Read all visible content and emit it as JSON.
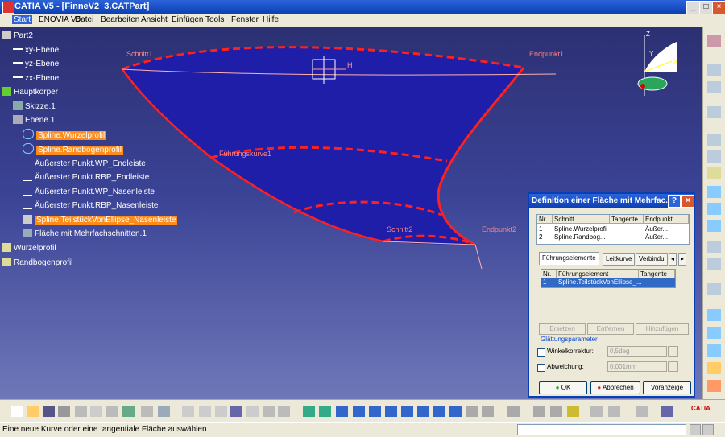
{
  "window": {
    "title": "CATIA V5 - [FinneV2_3.CATPart]"
  },
  "menu": [
    "Start",
    "ENOVIA V5",
    "Datei",
    "Bearbeiten",
    "Ansicht",
    "Einfügen",
    "Tools",
    "Fenster",
    "Hilfe"
  ],
  "tree": {
    "root": "Part2",
    "planes": [
      "xy-Ebene",
      "yz-Ebene",
      "zx-Ebene"
    ],
    "body": "Hauptkörper",
    "body_items": [
      "Skizze.1",
      "Ebene.1",
      "Spline.Wurzelprofil",
      "Spline.Randbogenprofil",
      "Äußerster Punkt.WP_Endleiste",
      "Äußerster Punkt.RBP_Endleiste",
      "Äußerster Punkt.WP_Nasenleiste",
      "Äußerster Punkt.RBP_Nasenleiste",
      "Spline.TeilstückVonEllipse_Nasenleiste",
      "Fläche mit Mehrfachschnitten.1"
    ],
    "others": [
      "Wurzelprofil",
      "Randbogenprofil"
    ]
  },
  "viewport": {
    "labels": [
      "Schnitt1",
      "Endpunkt1",
      "Führungskurve1",
      "Schnitt2",
      "Endpunkt2"
    ],
    "compass_axes": [
      "Z",
      "Y",
      "X"
    ],
    "plane_label": "H"
  },
  "dialog": {
    "title": "Definition einer Fläche mit Mehrfac...",
    "sections_header": [
      "Nr.",
      "Schnitt",
      "Tangente",
      "Endpunkt"
    ],
    "sections": [
      {
        "nr": "1",
        "name": "Spline.Wurzelprofil",
        "tangent": "",
        "end": "Äußer..."
      },
      {
        "nr": "2",
        "name": "Spline.Randbog...",
        "tangent": "",
        "end": "Äußer..."
      }
    ],
    "tabs": [
      "Führungselemente",
      "Leitkurve",
      "Verbindu"
    ],
    "guide_header": [
      "Nr.",
      "Führungselement",
      "Tangente"
    ],
    "guides": [
      {
        "nr": "1",
        "name": "Spline.TeilstückVonEllipse_..."
      }
    ],
    "buttons": [
      "Ersetzen",
      "Entfernen",
      "Hinzufügen"
    ],
    "smoothing_label": "Glättungsparameter",
    "angle_label": "Winkelkorrektur:",
    "angle_value": "0,5deg",
    "deviation_label": "Abweichung:",
    "deviation_value": "0,001mm",
    "ok": "OK",
    "cancel": "Abbrechen",
    "preview": "Voranzeige"
  },
  "status": {
    "message": "Eine neue Kurve oder eine tangentiale Fläche auswählen"
  },
  "brand": "CATIA"
}
